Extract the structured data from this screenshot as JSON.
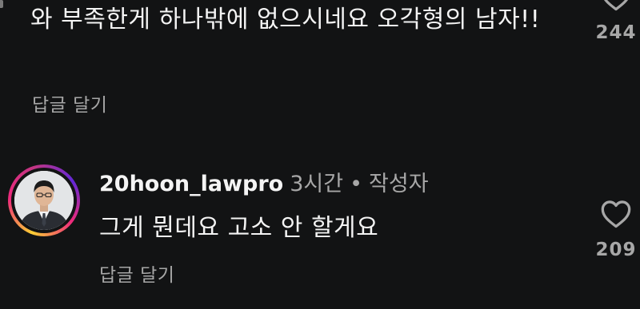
{
  "comments": [
    {
      "text": "와 부족한게 하나밖에 없으시네요 오각형의 남자!!",
      "reply_label": "답글 달기",
      "like_count": "244"
    },
    {
      "username": "20hoon_lawpro",
      "time": "3시간",
      "separator": "•",
      "author_badge": "작성자",
      "text": "그게 뭔데요 고소 안 할게요",
      "reply_label": "답글 달기",
      "like_count": "209"
    }
  ],
  "icons": {
    "like": "heart-outline-icon"
  },
  "colors": {
    "background": "#121314",
    "text_primary": "#f4f4f4",
    "text_secondary": "#a7a7a7",
    "story_ring": [
      "#f9ce34",
      "#ee2a7b",
      "#6228d7"
    ]
  }
}
